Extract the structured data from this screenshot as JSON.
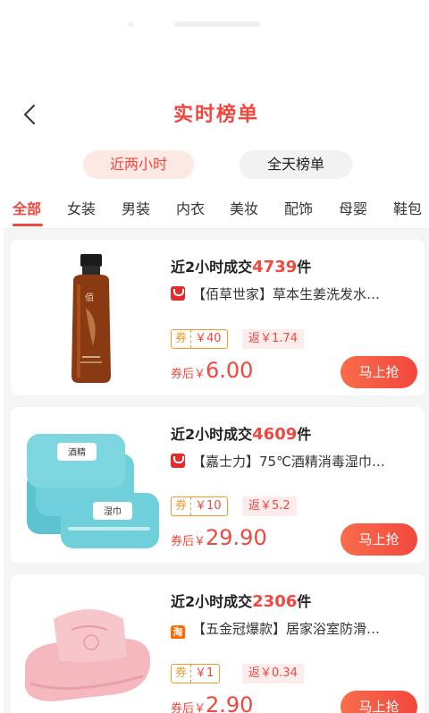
{
  "header": {
    "title": "实时榜单",
    "back_icon": "chevron-left-icon",
    "segments": [
      "近两小时",
      "全天榜单"
    ],
    "active_segment": 0
  },
  "categories": [
    "全部",
    "女装",
    "男装",
    "内衣",
    "美妆",
    "配饰",
    "母婴",
    "鞋包"
  ],
  "active_category": 0,
  "colors": {
    "accent": "#f2473e",
    "coupon_border": "#f39a2a",
    "sheet_bg": "#f5f5f5"
  },
  "products": [
    {
      "sales_prefix": "近2小时成交",
      "sales_count": "4739",
      "sales_suffix": "件",
      "platform_icon": "tmall-icon",
      "name": "【佰草世家】草本生姜洗发水…",
      "coupon_label": "券",
      "coupon_value": "￥40",
      "rebate": "返￥1.74",
      "price_label": "券后￥",
      "price": "6.00",
      "buy_label": "马上抢",
      "image_icon": "shampoo-bottle-image"
    },
    {
      "sales_prefix": "近2小时成交",
      "sales_count": "4609",
      "sales_suffix": "件",
      "platform_icon": "tmall-icon",
      "name": "【嘉士力】75℃酒精消毒湿巾…",
      "coupon_label": "券",
      "coupon_value": "￥10",
      "rebate": "返￥5.2",
      "price_label": "券后￥",
      "price": "29.90",
      "buy_label": "马上抢",
      "image_icon": "wet-wipes-image"
    },
    {
      "sales_prefix": "近2小时成交",
      "sales_count": "2306",
      "sales_suffix": "件",
      "platform_icon": "taobao-icon",
      "platform_badge": "淘",
      "name": "【五金冠爆款】居家浴室防滑…",
      "coupon_label": "券",
      "coupon_value": "￥1",
      "rebate": "返￥0.34",
      "price_label": "券后￥",
      "price": "2.90",
      "buy_label": "马上抢",
      "image_icon": "slippers-image"
    }
  ]
}
